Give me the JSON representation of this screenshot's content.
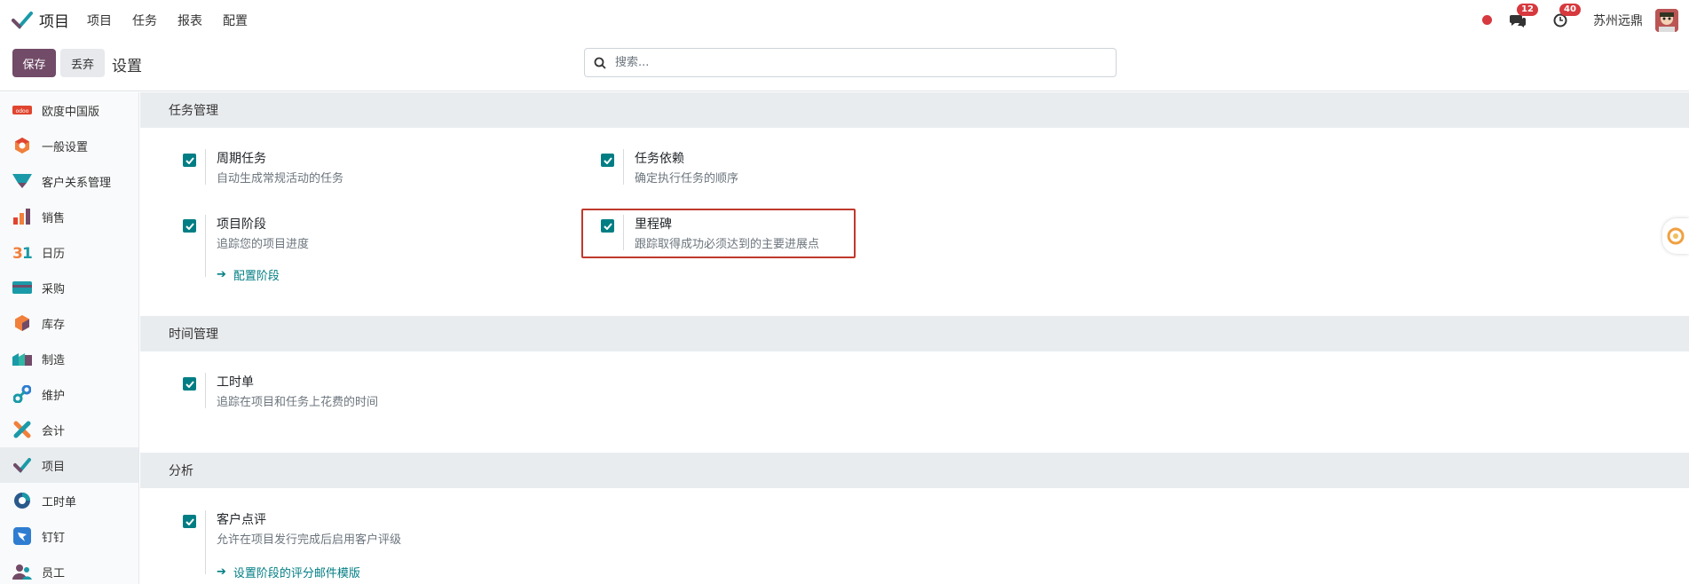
{
  "navbar": {
    "app_title": "项目",
    "menu": [
      "项目",
      "任务",
      "报表",
      "配置"
    ],
    "messages_count": "12",
    "activities_count": "40",
    "company": "苏州远鼎"
  },
  "control": {
    "save_label": "保存",
    "discard_label": "丢弃",
    "title": "设置",
    "search_placeholder": "搜索..."
  },
  "sidebar": {
    "items": [
      {
        "label": "欧度中国版",
        "icon": "odoo-china-icon",
        "active": false
      },
      {
        "label": "一般设置",
        "icon": "general-settings-icon",
        "active": false
      },
      {
        "label": "客户关系管理",
        "icon": "crm-icon",
        "active": false
      },
      {
        "label": "销售",
        "icon": "sales-icon",
        "active": false
      },
      {
        "label": "日历",
        "icon": "calendar-icon",
        "active": false
      },
      {
        "label": "采购",
        "icon": "purchase-icon",
        "active": false
      },
      {
        "label": "库存",
        "icon": "inventory-icon",
        "active": false
      },
      {
        "label": "制造",
        "icon": "manufacturing-icon",
        "active": false
      },
      {
        "label": "维护",
        "icon": "maintenance-icon",
        "active": false
      },
      {
        "label": "会计",
        "icon": "accounting-icon",
        "active": false
      },
      {
        "label": "项目",
        "icon": "project-icon",
        "active": true
      },
      {
        "label": "工时单",
        "icon": "timesheet-icon",
        "active": false
      },
      {
        "label": "钉钉",
        "icon": "dingtalk-icon",
        "active": false
      },
      {
        "label": "员工",
        "icon": "employees-icon",
        "active": false
      }
    ]
  },
  "sections": {
    "task_mgmt": {
      "title": "任务管理",
      "recurring": {
        "label": "周期任务",
        "desc": "自动生成常规活动的任务",
        "checked": true
      },
      "dependencies": {
        "label": "任务依赖",
        "desc": "确定执行任务的顺序",
        "checked": true
      },
      "stages": {
        "label": "项目阶段",
        "desc": "追踪您的项目进度",
        "link": "配置阶段",
        "checked": true
      },
      "milestones": {
        "label": "里程碑",
        "desc": "跟踪取得成功必须达到的主要进展点",
        "checked": true
      }
    },
    "time_mgmt": {
      "title": "时间管理",
      "timesheets": {
        "label": "工时单",
        "desc": "追踪在项目和任务上花费的时间",
        "checked": true
      }
    },
    "analysis": {
      "title": "分析",
      "rating": {
        "label": "客户点评",
        "desc": "允许在项目发行完成后启用客户评级",
        "link": "设置阶段的评分邮件模版",
        "checked": true
      }
    }
  },
  "colors": {
    "brand": "#714b67",
    "checkbox": "#017e84",
    "badge": "#d6393e",
    "highlight": "#c0392b"
  }
}
